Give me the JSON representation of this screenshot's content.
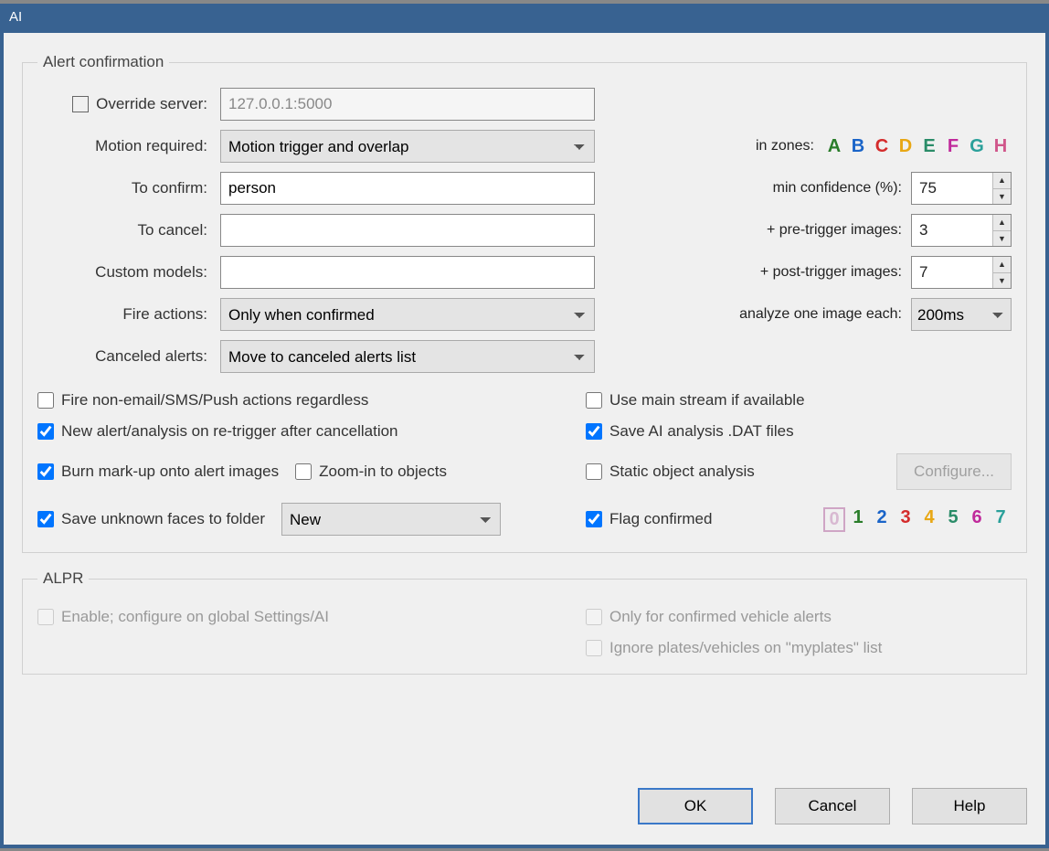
{
  "window": {
    "title": "AI"
  },
  "groups": {
    "alert_confirmation": "Alert confirmation",
    "alpr": "ALPR"
  },
  "labels": {
    "override_server": "Override server:",
    "motion_required": "Motion required:",
    "to_confirm": "To confirm:",
    "to_cancel": "To cancel:",
    "custom_models": "Custom models:",
    "fire_actions": "Fire actions:",
    "canceled_alerts": "Canceled alerts:",
    "in_zones": "in zones:",
    "min_confidence": "min confidence (%):",
    "pre_trigger": "+ pre-trigger images:",
    "post_trigger": "+ post-trigger images:",
    "analyze_each": "analyze one image each:"
  },
  "values": {
    "server": "127.0.0.1:5000",
    "motion_required": "Motion trigger and overlap",
    "to_confirm": "person",
    "to_cancel": "",
    "custom_models": "",
    "fire_actions": "Only when confirmed",
    "canceled_alerts": "Move to canceled alerts list",
    "min_confidence": "75",
    "pre_trigger": "3",
    "post_trigger": "7",
    "analyze_each": "200ms",
    "faces_folder": "New"
  },
  "zones": [
    {
      "l": "A",
      "c": "#2a7d2a"
    },
    {
      "l": "B",
      "c": "#1a64c8"
    },
    {
      "l": "C",
      "c": "#d42b2b"
    },
    {
      "l": "D",
      "c": "#e8a714"
    },
    {
      "l": "E",
      "c": "#2a8c68"
    },
    {
      "l": "F",
      "c": "#c02a9b"
    },
    {
      "l": "G",
      "c": "#2aa09a"
    },
    {
      "l": "H",
      "c": "#d0568a"
    }
  ],
  "flags": [
    {
      "l": "0",
      "c": "#cfa5c5",
      "boxed": true
    },
    {
      "l": "1",
      "c": "#2a7d2a"
    },
    {
      "l": "2",
      "c": "#1a64c8"
    },
    {
      "l": "3",
      "c": "#d42b2b"
    },
    {
      "l": "4",
      "c": "#e8a714"
    },
    {
      "l": "5",
      "c": "#2a8c68"
    },
    {
      "l": "6",
      "c": "#c02a9b"
    },
    {
      "l": "7",
      "c": "#2aa09a"
    }
  ],
  "checks": {
    "override_server": {
      "label": "Override server:",
      "checked": false
    },
    "fire_regardless": {
      "label": "Fire non-email/SMS/Push actions regardless",
      "checked": false
    },
    "use_main_stream": {
      "label": "Use main stream if available",
      "checked": false
    },
    "new_alert_retrigger": {
      "label": "New alert/analysis on re-trigger after cancellation",
      "checked": true
    },
    "save_dat": {
      "label": "Save AI analysis .DAT files",
      "checked": true
    },
    "burn_markup": {
      "label": "Burn mark-up onto alert images",
      "checked": true
    },
    "zoom_in": {
      "label": "Zoom-in to objects",
      "checked": false
    },
    "static_object": {
      "label": "Static object analysis",
      "checked": false
    },
    "save_faces": {
      "label": "Save unknown faces to folder",
      "checked": true
    },
    "flag_confirmed": {
      "label": "Flag confirmed",
      "checked": true
    },
    "alpr_enable": {
      "label": "Enable; configure on global Settings/AI",
      "checked": false,
      "disabled": true
    },
    "alpr_confirmed_only": {
      "label": "Only for confirmed vehicle alerts",
      "checked": false,
      "disabled": true
    },
    "alpr_ignore_myplates": {
      "label": "Ignore plates/vehicles on \"myplates\" list",
      "checked": false,
      "disabled": true
    }
  },
  "buttons": {
    "configure": "Configure...",
    "ok": "OK",
    "cancel": "Cancel",
    "help": "Help"
  }
}
